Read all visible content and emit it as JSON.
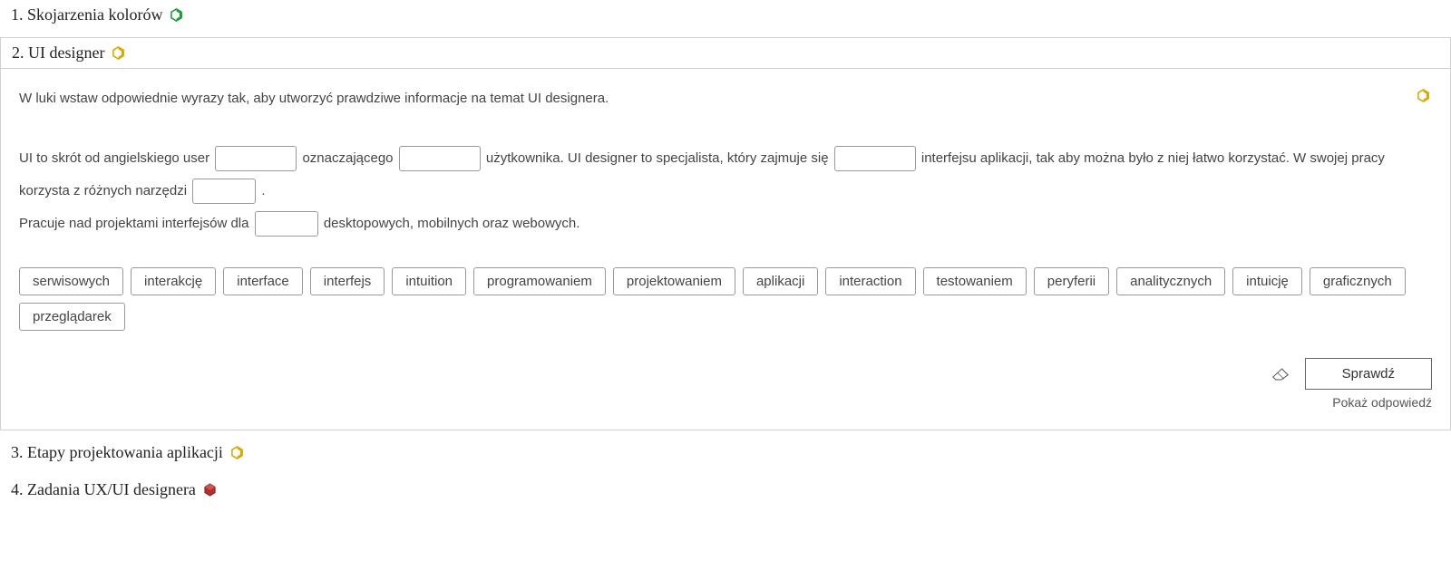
{
  "sections": {
    "s1": {
      "title": "1. Skojarzenia kolorów",
      "difficulty": "green"
    },
    "s2": {
      "title": "2. UI designer",
      "difficulty": "yellow"
    },
    "s3": {
      "title": "3. Etapy projektowania aplikacji",
      "difficulty": "yellow"
    },
    "s4": {
      "title": "4. Zadania UX/UI designera",
      "difficulty": "red"
    }
  },
  "exercise": {
    "instruction": "W luki wstaw odpowiednie wyrazy tak, aby utworzyć prawdziwe informacje na temat UI designera.",
    "text": {
      "p1a": "UI to skrót od angielskiego user ",
      "p1b": " oznaczającego ",
      "p1c": " użytkownika. UI designer to specjalista, który zajmuje się ",
      "p1d": " interfejsu aplikacji, tak aby można było z niej łatwo korzystać. W swojej pracy korzysta z różnych narzędzi ",
      "p1e": " .",
      "p2a": "Pracuje nad projektami interfejsów dla ",
      "p2b": " desktopowych, mobilnych oraz webowych."
    },
    "words": {
      "w0": "serwisowych",
      "w1": "interakcję",
      "w2": "interface",
      "w3": "interfejs",
      "w4": "intuition",
      "w5": "programowaniem",
      "w6": "projektowaniem",
      "w7": "aplikacji",
      "w8": "interaction",
      "w9": "testowaniem",
      "w10": "peryferii",
      "w11": "analitycznych",
      "w12": "intuicję",
      "w13": "graficznych",
      "w14": "przeglądarek"
    },
    "check_label": "Sprawdź",
    "show_answer_label": "Pokaż odpowiedź"
  },
  "colors": {
    "green": "#1a9e3a",
    "yellow": "#d9a800",
    "red": "#b03030"
  }
}
